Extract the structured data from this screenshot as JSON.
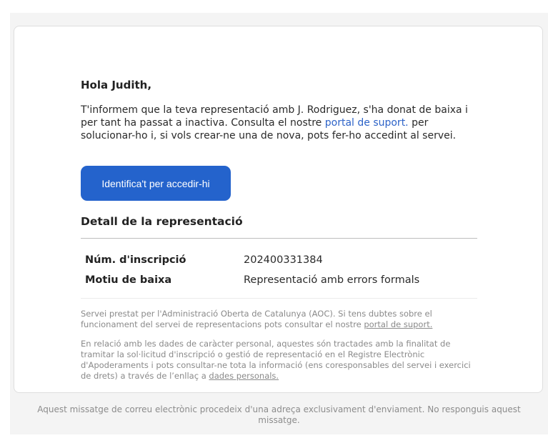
{
  "email": {
    "greeting": "Hola Judith,",
    "intro_text": "T'informem que la teva representació amb J. Rodriguez, s'ha donat de baixa i per tant ha passat a inactiva. Consulta el nostre ",
    "intro_link": "portal de suport.",
    "intro_text_after": " per solucionar-ho i, si vols crear-ne una de nova, pots fer-ho accedint al servei.",
    "button_label": "Identifica't per accedir-hi",
    "section_title": "Detall de la representació",
    "details": [
      {
        "label": "Núm. d'inscripció",
        "value": "202400331384"
      },
      {
        "label": "Motiu de baixa",
        "value": "Representació amb errors formals"
      }
    ],
    "note1_text": "Servei prestat per l'Administració Oberta de Catalunya (AOC). Si tens dubtes sobre el funcionament del servei de representacions pots consultar el nostre ",
    "note1_link": "portal de suport.",
    "note2_text": "En relació amb les dades de caràcter personal, aquestes són tractades amb la finalitat de tramitar la sol·licitud d'inscripció o gestió de representació en el Registre Electrònic d'Apoderaments i pots consultar-ne tota la informació (ens coresponsables del servei i exercici de drets) a través de l’enllaç a ",
    "note2_link": "dades personals."
  },
  "footer": {
    "text": "Aquest missatge de correu electrònic procedeix d'una adreça exclusivament d'enviament. No responguis aquest missatge."
  },
  "colors": {
    "button": "#2463cc",
    "link": "#2d63c8",
    "background": "#f4f4f4"
  }
}
